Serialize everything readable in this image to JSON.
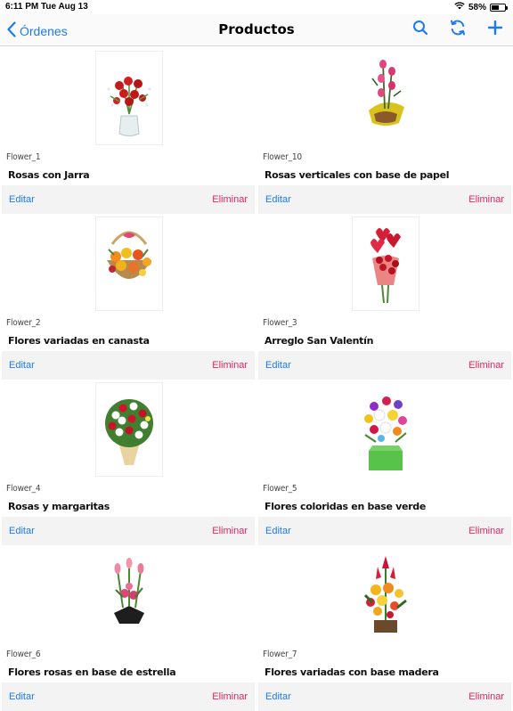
{
  "status": {
    "time": "6:11 PM",
    "date": "Tue Aug 13",
    "battery": "58%",
    "battery_level": 0.58
  },
  "nav": {
    "back_label": "Órdenes",
    "title": "Productos"
  },
  "colors": {
    "accent": "#1a7bf2",
    "delete": "#e0245e"
  },
  "products": [
    {
      "code": "Flower_1",
      "name": "Rosas con Jarra",
      "edit": "Editar",
      "delete": "Eliminar"
    },
    {
      "code": "Flower_10",
      "name": "Rosas verticales con base de papel",
      "edit": "Editar",
      "delete": "Eliminar"
    },
    {
      "code": "Flower_2",
      "name": "Flores variadas en canasta",
      "edit": "Editar",
      "delete": "Eliminar"
    },
    {
      "code": "Flower_3",
      "name": "Arreglo San Valentín",
      "edit": "Editar",
      "delete": "Eliminar"
    },
    {
      "code": "Flower_4",
      "name": "Rosas y margaritas",
      "edit": "Editar",
      "delete": "Eliminar"
    },
    {
      "code": "Flower_5",
      "name": "Flores coloridas en base verde",
      "edit": "Editar",
      "delete": "Eliminar"
    },
    {
      "code": "Flower_6",
      "name": "Flores rosas en base de estrella",
      "edit": "Editar",
      "delete": "Eliminar"
    },
    {
      "code": "Flower_7",
      "name": "Flores variadas con base madera",
      "edit": "Editar",
      "delete": "Eliminar"
    }
  ]
}
